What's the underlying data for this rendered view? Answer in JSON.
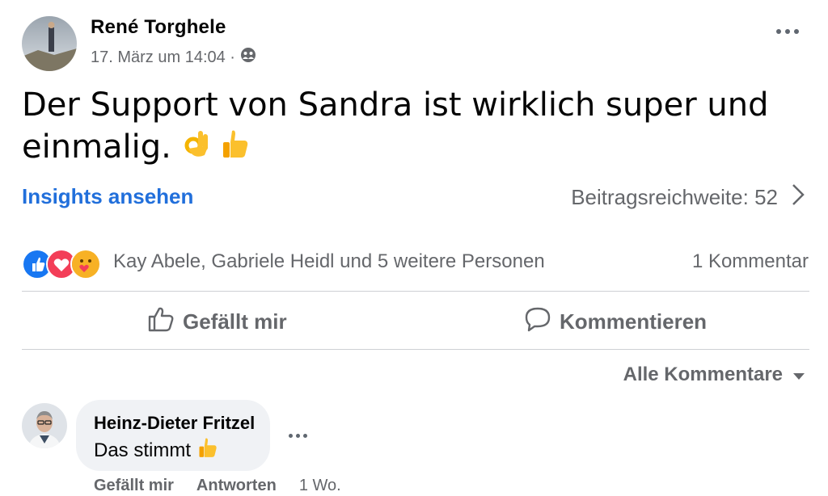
{
  "post": {
    "author": "René Torghele",
    "timestamp": "17. März um 14:04 ·",
    "audience_icon": "friends-icon",
    "text": "Der Support von Sandra ist wirklich super und einmalig.",
    "emojis": [
      "ok-hand-emoji",
      "thumbs-up-emoji"
    ]
  },
  "insights": {
    "link_label": "Insights ansehen",
    "reach_label": "Beitragsreichweite: 52"
  },
  "reactions": {
    "icons": [
      "like-reaction-icon",
      "love-reaction-icon",
      "care-reaction-icon"
    ],
    "names": "Kay Abele, Gabriele Heidl und 5 weitere Personen",
    "comment_count": "1 Kommentar"
  },
  "actions": {
    "like_label": "Gefällt mir",
    "comment_label": "Kommentieren"
  },
  "comments_filter": {
    "label": "Alle Kommentare"
  },
  "comment": {
    "author": "Heinz-Dieter Fritzel",
    "text": "Das stimmt",
    "like_label": "Gefällt mir",
    "reply_label": "Antworten",
    "age": "1 Wo."
  },
  "colors": {
    "link_blue": "#216fdb",
    "secondary_text": "#65676b",
    "divider": "#ced0d4",
    "bubble_bg": "#f0f2f5"
  }
}
